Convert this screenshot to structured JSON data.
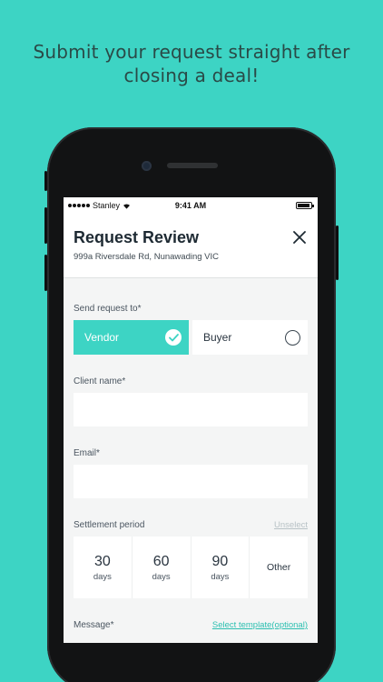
{
  "headline": {
    "line1": "Submit your request straight after",
    "line2": "closing a deal!"
  },
  "status_bar": {
    "carrier": "Stanley",
    "time": "9:41 AM",
    "battery_level": 0.9
  },
  "header": {
    "title": "Request Review",
    "address": "999a Riversdale Rd, Nunawading VIC"
  },
  "send_to": {
    "label": "Send request to*",
    "options": [
      {
        "label": "Vendor",
        "selected": true
      },
      {
        "label": "Buyer",
        "selected": false
      }
    ]
  },
  "client_name": {
    "label": "Client name*",
    "value": ""
  },
  "email": {
    "label": "Email*",
    "value": ""
  },
  "settlement": {
    "label": "Settlement period",
    "unselect_label": "Unselect",
    "options": [
      {
        "number": "30",
        "unit": "days"
      },
      {
        "number": "60",
        "unit": "days"
      },
      {
        "number": "90",
        "unit": "days"
      },
      {
        "label": "Other"
      }
    ]
  },
  "message": {
    "label": "Message*",
    "template_link": "Select template(optional)"
  },
  "colors": {
    "accent": "#3dd4c4",
    "background": "#3dd4c4",
    "headline": "#2a4a47",
    "phone": "#121314"
  }
}
